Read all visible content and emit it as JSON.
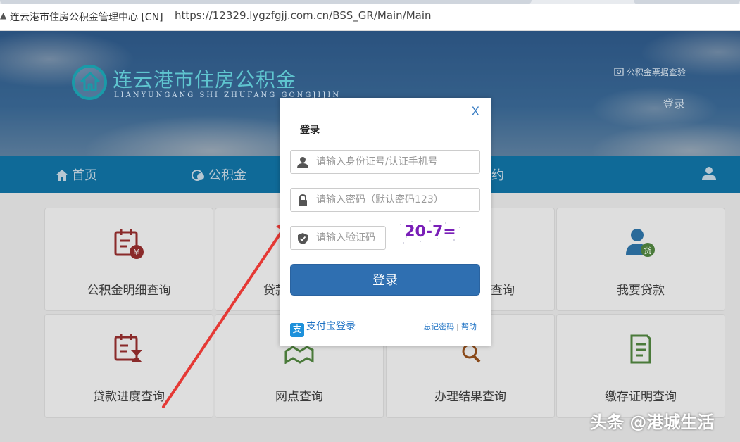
{
  "browser": {
    "site_name": "连云港市住房公积金管理中心 [CN]",
    "url": "https://12329.lygzfgjj.com.cn/BSS_GR/Main/Main"
  },
  "header": {
    "logo_cn": "连云港市住房公积金",
    "logo_en": "LIANYUNGANG SHI ZHUFANG GONGJIJIN",
    "receipt_link": "公积金票据查验",
    "login_link": "登录"
  },
  "nav": {
    "items": [
      {
        "label": "首页"
      },
      {
        "label": "公积金"
      },
      {
        "label": "约"
      }
    ]
  },
  "services": [
    {
      "label": "公积金明细查询"
    },
    {
      "label": "贷款"
    },
    {
      "label": "查询"
    },
    {
      "label": "我要贷款"
    },
    {
      "label": "贷款进度查询"
    },
    {
      "label": "网点查询"
    },
    {
      "label": "办理结果查询"
    },
    {
      "label": "缴存证明查询"
    }
  ],
  "modal": {
    "close": "X",
    "title": "登录",
    "id_placeholder": "请输入身份证号/认证手机号",
    "password_placeholder": "请输入密码（默认密码123）",
    "captcha_placeholder": "请输入验证码",
    "captcha_text": "20-7=",
    "login_button": "登录",
    "alipay_icon": "支",
    "alipay_login": "支付宝登录",
    "forgot_password": "忘记密码",
    "separator": "|",
    "help": "帮助"
  },
  "colors": {
    "nav_bg": "#0f6a98",
    "button": "#2f6fb1",
    "link": "#1e72c4",
    "arrow": "#e53935",
    "icon_red": "#8a2a2a",
    "icon_green": "#4a7a3a",
    "icon_blue": "#2a6a9a"
  },
  "watermark": "头条 @港城生活"
}
